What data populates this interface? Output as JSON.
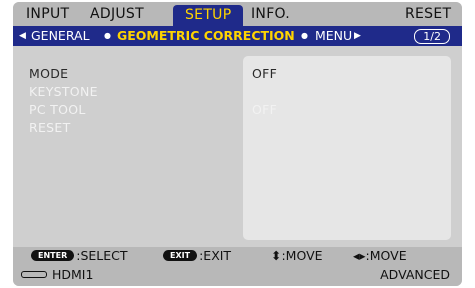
{
  "tabs": [
    {
      "label": "INPUT"
    },
    {
      "label": "ADJUST"
    },
    {
      "label": "SETUP"
    },
    {
      "label": "INFO."
    },
    {
      "label": "RESET"
    }
  ],
  "subtabs": {
    "left_arrow": "◀",
    "general": "GENERAL",
    "dot1": "●",
    "active": "GEOMETRIC CORRECTION",
    "dot2": "●",
    "menu": "MENU",
    "right_arrow": "▶",
    "page": "1/2"
  },
  "menu_items": [
    {
      "label": "MODE",
      "value": "OFF"
    },
    {
      "label": "KEYSTONE",
      "value": ""
    },
    {
      "label": "PC TOOL",
      "value": "OFF"
    },
    {
      "label": "RESET",
      "value": ""
    }
  ],
  "footer": {
    "enter_key": "ENTER",
    "enter_label": ":SELECT",
    "exit_key": "EXIT",
    "exit_label": ":EXIT",
    "move_updown": "⬍:MOVE",
    "move_leftright": "◂▸:MOVE"
  },
  "status": {
    "source": "HDMI1",
    "mode": "ADVANCED"
  },
  "colors": {
    "active_tab_bg": "#1f2a8a",
    "active_text": "#ffd400"
  }
}
